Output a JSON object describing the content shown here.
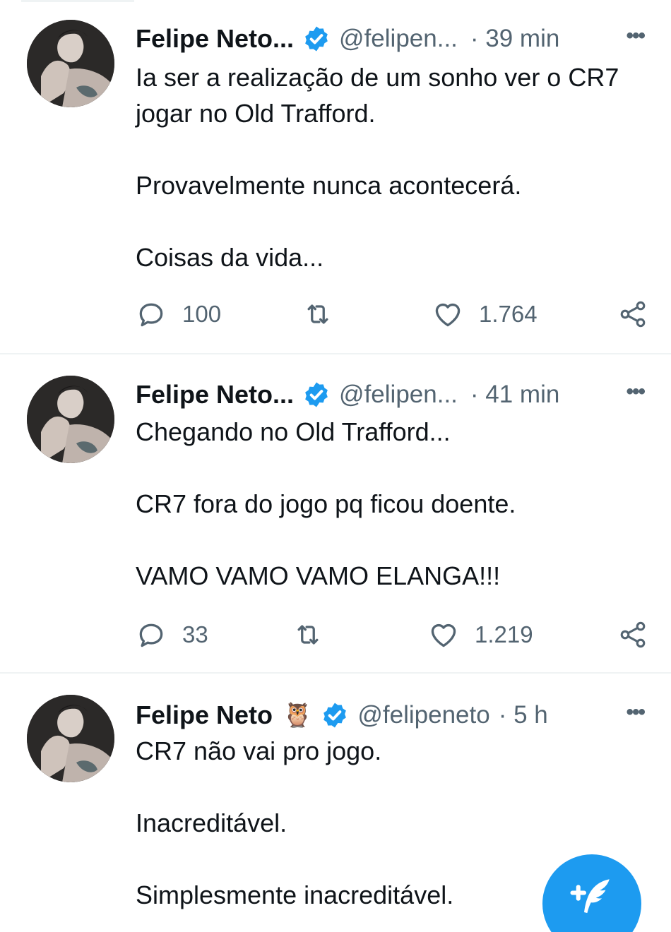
{
  "tweets": [
    {
      "name": "Felipe Neto...",
      "emoji": "",
      "handle": "@felipen...",
      "time": "· 39 min",
      "lines": [
        "Ia ser a realização de um sonho ver o CR7",
        "jogar no Old Trafford.",
        "",
        "Provavelmente nunca acontecerá.",
        "",
        "Coisas da vida..."
      ],
      "replies": "100",
      "likes": "1.764"
    },
    {
      "name": "Felipe Neto...",
      "emoji": "",
      "handle": "@felipen...",
      "time": "· 41 min",
      "lines": [
        "Chegando no Old Trafford...",
        "",
        "CR7 fora do jogo pq ficou doente.",
        "",
        "VAMO VAMO VAMO ELANGA!!!"
      ],
      "replies": "33",
      "likes": "1.219"
    },
    {
      "name": "Felipe Neto",
      "emoji": "🦉",
      "handle": "@felipeneto",
      "time": "· 5 h",
      "lines": [
        "CR7 não vai pro jogo.",
        "",
        "Inacreditável.",
        "",
        "Simplesmente inacreditável."
      ]
    }
  ],
  "icons": {
    "more": "more-icon",
    "verified": "verified-badge-icon",
    "reply": "reply-icon",
    "retweet": "retweet-icon",
    "like": "heart-icon",
    "share": "share-icon",
    "compose": "compose-icon"
  },
  "colors": {
    "accent": "#1d9bf0",
    "muted": "#536471",
    "text": "#0f1419",
    "divider": "#eff3f4"
  }
}
